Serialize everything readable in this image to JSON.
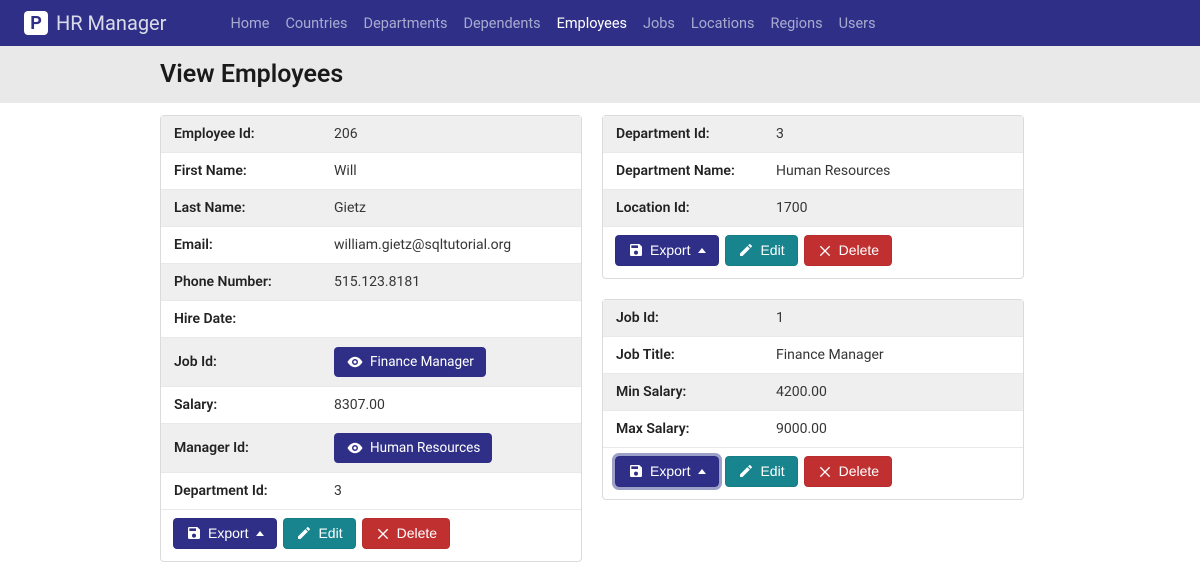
{
  "brand": "HR Manager",
  "nav": [
    {
      "label": "Home"
    },
    {
      "label": "Countries"
    },
    {
      "label": "Departments"
    },
    {
      "label": "Dependents"
    },
    {
      "label": "Employees",
      "active": true
    },
    {
      "label": "Jobs"
    },
    {
      "label": "Locations"
    },
    {
      "label": "Regions"
    },
    {
      "label": "Users"
    }
  ],
  "page_title": "View Employees",
  "employee_card": {
    "fields": {
      "employee_id_label": "Employee Id:",
      "employee_id": "206",
      "first_name_label": "First Name:",
      "first_name": "Will",
      "last_name_label": "Last Name:",
      "last_name": "Gietz",
      "email_label": "Email:",
      "email": "william.gietz@sqltutorial.org",
      "phone_label": "Phone Number:",
      "phone": "515.123.8181",
      "hire_date_label": "Hire Date:",
      "hire_date": "",
      "job_id_label": "Job Id:",
      "job_id_chip": "Finance Manager",
      "salary_label": "Salary:",
      "salary": "8307.00",
      "manager_id_label": "Manager Id:",
      "manager_id_chip": "Human Resources",
      "dept_id_label": "Department Id:",
      "dept_id": "3"
    }
  },
  "department_card": {
    "fields": {
      "dept_id_label": "Department Id:",
      "dept_id": "3",
      "dept_name_label": "Department Name:",
      "dept_name": "Human Resources",
      "location_id_label": "Location Id:",
      "location_id": "1700"
    }
  },
  "job_card": {
    "fields": {
      "job_id_label": "Job Id:",
      "job_id": "1",
      "job_title_label": "Job Title:",
      "job_title": "Finance Manager",
      "min_salary_label": "Min Salary:",
      "min_salary": "4200.00",
      "max_salary_label": "Max Salary:",
      "max_salary": "9000.00"
    }
  },
  "buttons": {
    "export": "Export",
    "edit": "Edit",
    "delete": "Delete"
  }
}
